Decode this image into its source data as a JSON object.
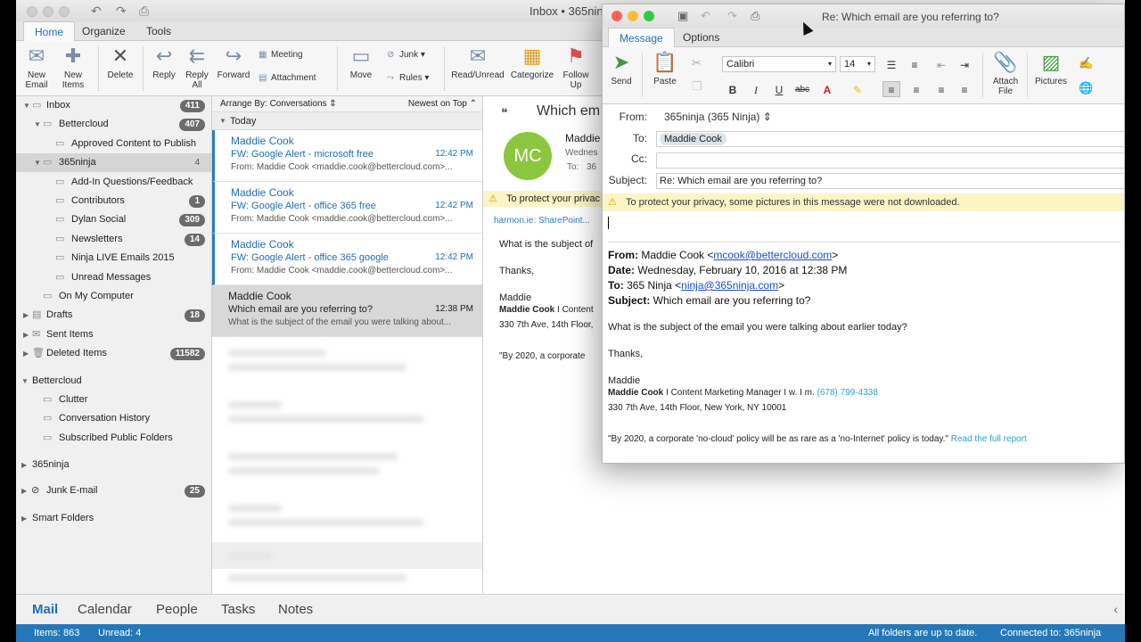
{
  "main": {
    "title": "Inbox • 365ninja",
    "tabs": [
      "Home",
      "Organize",
      "Tools"
    ],
    "ribbon": {
      "new_email": "New Email",
      "new_items": "New Items",
      "delete": "Delete",
      "reply": "Reply",
      "reply_all": "Reply All",
      "forward": "Forward",
      "meeting": "Meeting",
      "attachment": "Attachment",
      "move": "Move",
      "junk": "Junk",
      "rules": "Rules",
      "read_unread": "Read/Unread",
      "categorize": "Categorize",
      "follow_up": "Follow Up"
    }
  },
  "sidebar": {
    "folders": [
      {
        "label": "Inbox",
        "badge": "411",
        "level": 0,
        "tri": "▼",
        "icon": "inbox"
      },
      {
        "label": "Bettercloud",
        "badge": "407",
        "level": 1,
        "tri": "▼",
        "icon": "inbox"
      },
      {
        "label": "Approved Content to Publish",
        "badge": "",
        "level": 2,
        "tri": "",
        "icon": "folder"
      },
      {
        "label": "365ninja",
        "badge": "4",
        "level": 1,
        "tri": "▼",
        "icon": "inbox",
        "selected": true
      },
      {
        "label": "Add-In Questions/Feedback",
        "badge": "",
        "level": 2,
        "tri": "",
        "icon": "folder"
      },
      {
        "label": "Contributors",
        "badge": "1",
        "level": 2,
        "tri": "",
        "icon": "folder"
      },
      {
        "label": "Dylan Social",
        "badge": "309",
        "level": 2,
        "tri": "",
        "icon": "folder"
      },
      {
        "label": "Newsletters",
        "badge": "14",
        "level": 2,
        "tri": "",
        "icon": "folder"
      },
      {
        "label": "Ninja LIVE Emails 2015",
        "badge": "",
        "level": 2,
        "tri": "",
        "icon": "folder"
      },
      {
        "label": "Unread Messages",
        "badge": "",
        "level": 2,
        "tri": "",
        "icon": "folder"
      },
      {
        "label": "On My Computer",
        "badge": "",
        "level": 1,
        "tri": "",
        "icon": "inbox"
      },
      {
        "label": "Drafts",
        "badge": "18",
        "level": 0,
        "tri": "▶",
        "icon": "draft"
      },
      {
        "label": "Sent Items",
        "badge": "",
        "level": 0,
        "tri": "▶",
        "icon": "sent"
      },
      {
        "label": "Deleted Items",
        "badge": "11582",
        "level": 0,
        "tri": "▶",
        "icon": "trash"
      }
    ],
    "bettercloud_group": {
      "label": "Bettercloud",
      "items": [
        "Clutter",
        "Conversation History",
        "Subscribed Public Folders"
      ]
    },
    "ninja_group": "365ninja",
    "junk": {
      "label": "Junk E-mail",
      "badge": "25"
    },
    "smart": "Smart Folders"
  },
  "msglist": {
    "arrange": "Arrange By: Conversations",
    "sort": "Newest on Top",
    "group": "Today",
    "messages": [
      {
        "from": "Maddie Cook",
        "subject": "FW: Google Alert - microsoft free",
        "time": "12:42 PM",
        "preview": "From: Maddie Cook <maddie.cook@bettercloud.com>..."
      },
      {
        "from": "Maddie Cook",
        "subject": "FW: Google Alert - office 365 free",
        "time": "12:42 PM",
        "preview": "From: Maddie Cook <maddie.cook@bettercloud.com>..."
      },
      {
        "from": "Maddie Cook",
        "subject": "FW: Google Alert - office 365 google",
        "time": "12:42 PM",
        "preview": "From: Maddie Cook <maddie.cook@bettercloud.com>..."
      },
      {
        "from": "Maddie Cook",
        "subject": "Which email are you referring to?",
        "time": "12:38 PM",
        "preview": "What is the subject of the email you were talking about..."
      }
    ]
  },
  "reading": {
    "subject": "Which em",
    "avatar": "MC",
    "from": "Maddie",
    "date": "Wednes",
    "to_label": "To:",
    "to_val": "36",
    "privacy": "To protect your privac",
    "harmon": "harmon.ie: SharePoint...",
    "line1": "What is the subject of",
    "thanks": "Thanks,",
    "name": "Maddie",
    "sig_name": "Maddie Cook",
    "sig_rest": " I Content",
    "addr": "330 7th Ave, 14th Floor,",
    "quote": "\"By 2020, a corporate"
  },
  "bottomnav": [
    "Mail",
    "Calendar",
    "People",
    "Tasks",
    "Notes"
  ],
  "status": {
    "items": "Items: 863",
    "unread": "Unread: 4",
    "sync": "All folders are up to date.",
    "connected": "Connected to: 365ninja"
  },
  "compose": {
    "title": "Re: Which email are you referring to?",
    "tabs": [
      "Message",
      "Options"
    ],
    "send": "Send",
    "paste": "Paste",
    "font": "Calibri",
    "size": "14",
    "attach": "Attach File",
    "pictures": "Pictures",
    "from_label": "From:",
    "from_val": "365ninja (365 Ninja)",
    "to_label": "To:",
    "to_val": "Maddie Cook",
    "cc_label": "Cc:",
    "subject_label": "Subject:",
    "subject_val": "Re: Which email are you referring to?",
    "privacy": "To protect your privacy, some pictures in this message were not downloaded.",
    "q_from_label": "From:",
    "q_from_name": " Maddie Cook <",
    "q_from_email": "mcook@bettercloud.com",
    "q_from_end": ">",
    "q_date_label": "Date:",
    "q_date": " Wednesday, February 10, 2016 at 12:38 PM",
    "q_to_label": "To:",
    "q_to_name": " 365 Ninja <",
    "q_to_email": "ninja@365ninja.com",
    "q_to_end": ">",
    "q_subject_label": "Subject:",
    "q_subject": " Which email are you referring to?",
    "q_body": "What is the subject of the email you were talking about earlier today?",
    "q_thanks": "Thanks,",
    "q_name": "Maddie",
    "sig_name": "Maddie Cook",
    "sig_role": " I Content Marketing Manager I w. I m. ",
    "sig_phone": "(678) 799-4338",
    "sig_addr": "330 7th Ave, 14th Floor, New York, NY 10001",
    "quote": "\"By 2020, a corporate 'no-cloud' policy will be as rare as a 'no-Internet' policy is today.\" ",
    "quote_link": "Read the full report"
  },
  "colors": {
    "accent": "#1e6fc0",
    "status_bar": "#2578b8",
    "avatar": "#8cc63f",
    "warn": "#fbf5c6"
  }
}
